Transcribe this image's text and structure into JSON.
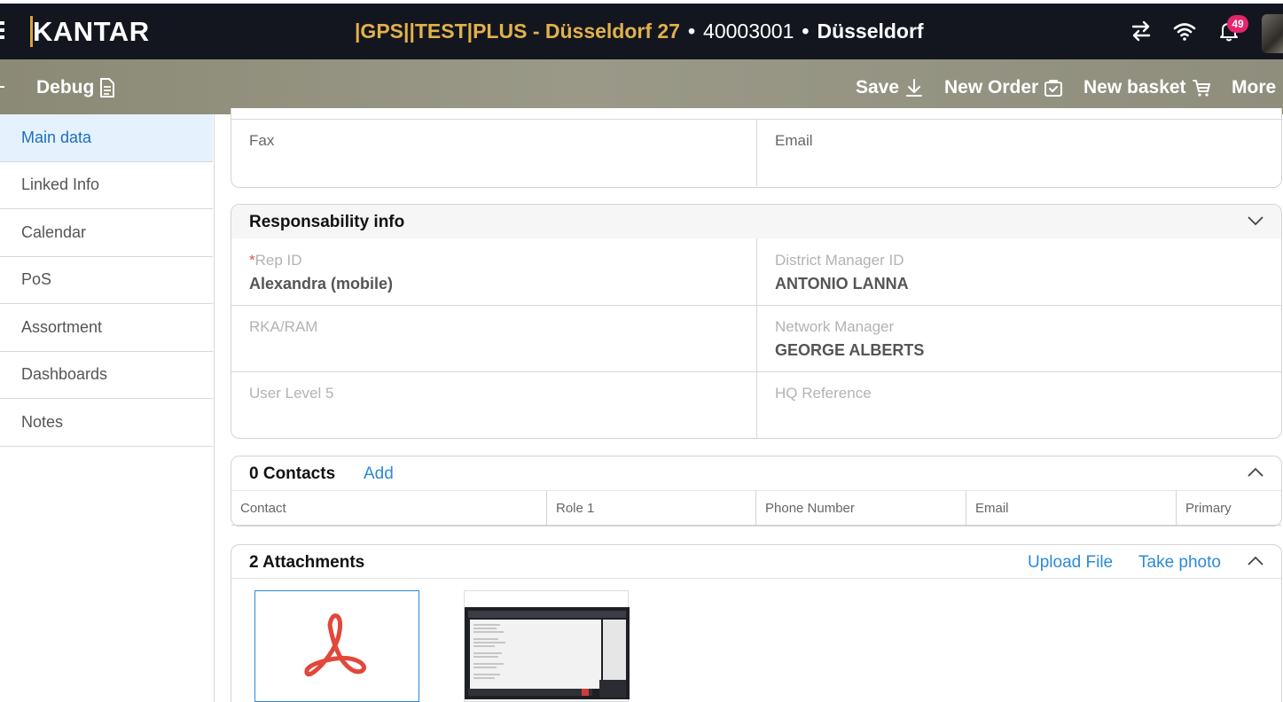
{
  "header": {
    "logo": "KANTAR",
    "store_name": "|GPS||TEST|PLUS - Düsseldorf 27",
    "store_code": "40003001",
    "city": "Düsseldorf",
    "notification_count": "49",
    "icons": [
      "menu-icon",
      "swap-icon",
      "wifi-icon",
      "bell-icon",
      "avatar"
    ]
  },
  "toolbar": {
    "debug_label": "Debug",
    "save_label": "Save",
    "new_order_label": "New Order",
    "new_basket_label": "New basket",
    "more_label": "More"
  },
  "sidebar": {
    "items": [
      {
        "label": "Main data",
        "active": true
      },
      {
        "label": "Linked Info"
      },
      {
        "label": "Calendar"
      },
      {
        "label": "PoS"
      },
      {
        "label": "Assortment"
      },
      {
        "label": "Dashboards"
      },
      {
        "label": "Notes"
      }
    ]
  },
  "contact_card": {
    "fax_label": "Fax",
    "email_label": "Email"
  },
  "responsibility": {
    "title": "Responsability info",
    "fields": [
      {
        "label": "Rep ID",
        "required": "*",
        "value": "Alexandra (mobile)"
      },
      {
        "label": "District Manager ID",
        "value": "ANTONIO LANNA"
      },
      {
        "label": "RKA/RAM",
        "value": ""
      },
      {
        "label": "Network Manager",
        "value": "GEORGE ALBERTS"
      },
      {
        "label": "User Level 5",
        "value": ""
      },
      {
        "label": "HQ Reference",
        "value": ""
      }
    ]
  },
  "contacts": {
    "title": "0 Contacts",
    "add_label": "Add",
    "columns": [
      "Contact",
      "Role 1",
      "Phone Number",
      "Email",
      "Primary"
    ]
  },
  "attachments": {
    "title": "2 Attachments",
    "upload_label": "Upload File",
    "photo_label": "Take photo",
    "files": [
      {
        "type": "pdf",
        "icon": "pdf-icon"
      },
      {
        "type": "image",
        "icon": "screenshot-thumbnail"
      }
    ]
  },
  "colors": {
    "header_bg": "#14161f",
    "store_name": "#e1b24a",
    "toolbar_bg": "#9a9988",
    "active_item_bg": "#e5f1fc",
    "active_item_text": "#1e6fc0",
    "link": "#2b8ad8",
    "badge": "#e5266c",
    "pdf_red": "#e2473a"
  }
}
